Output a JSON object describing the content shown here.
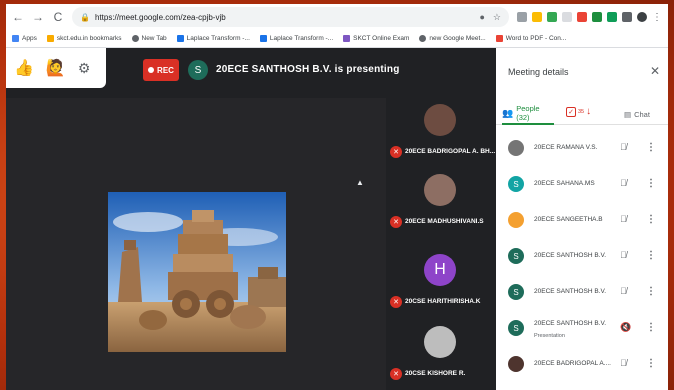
{
  "browser": {
    "url": "https://meet.google.com/zea-cpjb-vjb",
    "bookmarks": [
      {
        "label": "Apps",
        "color": "#4285f4"
      },
      {
        "label": "skct.edu.in bookmarks",
        "color": "#f9ab00"
      },
      {
        "label": "New Tab",
        "color": "#5f6368"
      },
      {
        "label": "Laplace Transform -...",
        "color": "#1a73e8"
      },
      {
        "label": "Laplace Transform -...",
        "color": "#1a73e8"
      },
      {
        "label": "SKCT Online Exam",
        "color": "#7e57c2"
      },
      {
        "label": "new Google Meet...",
        "color": "#5f6368"
      },
      {
        "label": "Word to PDF - Con...",
        "color": "#ea4335"
      }
    ]
  },
  "meet": {
    "rec_label": "REC",
    "presenter_initial": "S",
    "presenting_text": "20ECE SANTHOSH B.V. is presenting"
  },
  "tiles": [
    {
      "name": "20ECE BADRIGOPAL A. BH...",
      "face_color": "#6d4c41"
    },
    {
      "name": "20ECE MADHUSHIVANI.S",
      "face_color": "#8d6e63"
    },
    {
      "name": "20CSE HARITHIRISHA.K",
      "face_color": "#8e44c9",
      "initial": "H"
    },
    {
      "name": "20CSE KISHORE R.",
      "face_color": "#bdbdbd"
    }
  ],
  "panel": {
    "title": "Meeting details",
    "tab_people": "People (32)",
    "tab_attendance_count": "35",
    "tab_chat": "Chat",
    "participants": [
      {
        "name": "20ECE RAMANA V.S.",
        "initial": "",
        "color": "#757575"
      },
      {
        "name": "20ECE SAHANA.MS",
        "initial": "S",
        "color": "#12a4a4"
      },
      {
        "name": "20ECE SANGEETHA.B",
        "initial": "",
        "color": "#f4a030"
      },
      {
        "name": "20ECE SANTHOSH B.V.",
        "initial": "S",
        "color": "#1e6c5a"
      },
      {
        "name": "20ECE SANTHOSH B.V.",
        "initial": "S",
        "color": "#1e6c5a"
      },
      {
        "name": "20ECE SANTHOSH B.V.",
        "initial": "S",
        "color": "#1e6c5a",
        "sub": "Presentation"
      },
      {
        "name": "20ECE BADRIGOPAL A....",
        "initial": "",
        "color": "#4e342e"
      }
    ]
  }
}
